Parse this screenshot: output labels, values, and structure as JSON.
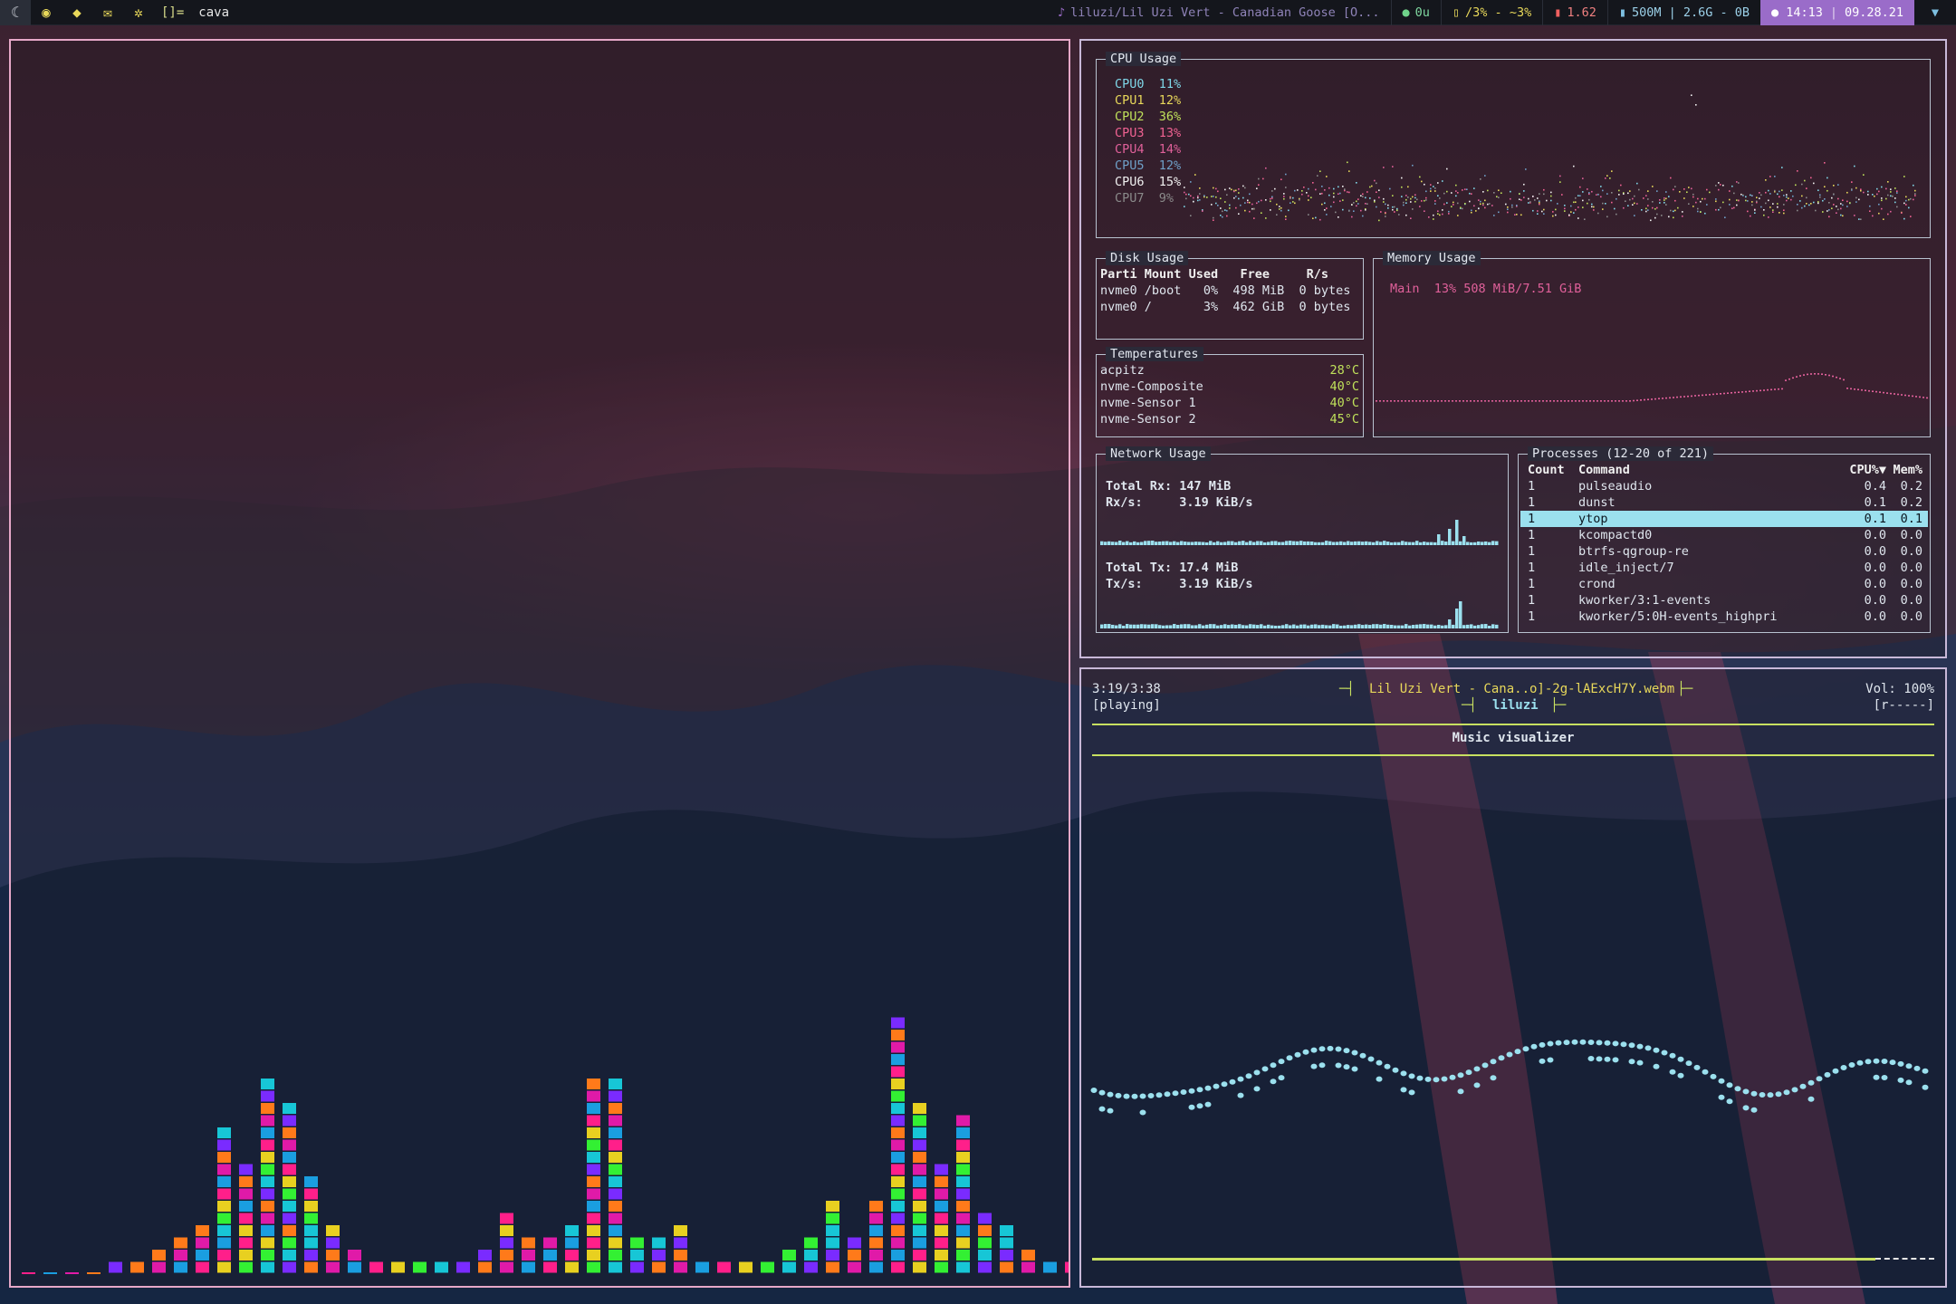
{
  "topbar": {
    "workspaces": [
      {
        "icon": "☾",
        "name": "workspace-1"
      },
      {
        "icon": "◉",
        "name": "workspace-2"
      },
      {
        "icon": "◆",
        "name": "workspace-3"
      },
      {
        "icon": "✉",
        "name": "workspace-4"
      },
      {
        "icon": "✲",
        "name": "workspace-5"
      }
    ],
    "layout": "[]=",
    "window_title": "cava",
    "now_playing": "liluzi/Lil Uzi Vert - Canadian Goose [O...",
    "updates": "0u",
    "cpu": "/3% - ~3%",
    "temp": "1.62",
    "memory": "500M | 2.6G - 0B",
    "time": "14:13",
    "date": "09.28.21"
  },
  "ytop": {
    "cpu": {
      "title": "CPU Usage",
      "cores": [
        {
          "label": "CPU0",
          "pct": "11%",
          "color": "#7fd7e8"
        },
        {
          "label": "CPU1",
          "pct": "12%",
          "color": "#e8d85a"
        },
        {
          "label": "CPU2",
          "pct": "36%",
          "color": "#bfe05a"
        },
        {
          "label": "CPU3",
          "pct": "13%",
          "color": "#f06292"
        },
        {
          "label": "CPU4",
          "pct": "14%",
          "color": "#e0609a"
        },
        {
          "label": "CPU5",
          "pct": "12%",
          "color": "#6fa0c8"
        },
        {
          "label": "CPU6",
          "pct": "15%",
          "color": "#f0f0f0"
        },
        {
          "label": "CPU7",
          "pct": "9%",
          "color": "#8a8a8a"
        }
      ]
    },
    "disk": {
      "title": "Disk Usage",
      "headers": [
        "Parti",
        "Mount",
        "Used",
        "Free",
        "R/s"
      ],
      "rows": [
        [
          "nvme0",
          "/boot",
          "0%",
          "498 MiB",
          "0 bytes"
        ],
        [
          "nvme0",
          "/",
          "3%",
          "462 GiB",
          "0 bytes"
        ]
      ]
    },
    "temps": {
      "title": "Temperatures",
      "rows": [
        {
          "name": "acpitz",
          "value": "28°C"
        },
        {
          "name": "nvme-Composite",
          "value": "40°C"
        },
        {
          "name": "nvme-Sensor 1",
          "value": "40°C"
        },
        {
          "name": "nvme-Sensor 2",
          "value": "45°C"
        }
      ]
    },
    "memory": {
      "title": "Memory Usage",
      "main_label": "Main",
      "main_value": "13% 508 MiB/7.51 GiB"
    },
    "network": {
      "title": "Network Usage",
      "total_rx_label": "Total Rx:",
      "total_rx": "147 MiB",
      "rx_label": "Rx/s:",
      "rx": "3.19 KiB/s",
      "total_tx_label": "Total Tx:",
      "total_tx": "17.4 MiB",
      "tx_label": "Tx/s:",
      "tx": "3.19 KiB/s"
    },
    "processes": {
      "title": "Processes (12-20 of 221)",
      "headers": {
        "count": "Count",
        "cmd": "Command",
        "cpu": "CPU%▼",
        "mem": "Mem%"
      },
      "rows": [
        {
          "count": "1",
          "cmd": "pulseaudio",
          "cpu": "0.4",
          "mem": "0.2"
        },
        {
          "count": "1",
          "cmd": "dunst",
          "cpu": "0.1",
          "mem": "0.2"
        },
        {
          "count": "1",
          "cmd": "ytop",
          "cpu": "0.1",
          "mem": "0.1",
          "selected": true
        },
        {
          "count": "1",
          "cmd": "kcompactd0",
          "cpu": "0.0",
          "mem": "0.0"
        },
        {
          "count": "1",
          "cmd": "btrfs-qgroup-re",
          "cpu": "0.0",
          "mem": "0.0"
        },
        {
          "count": "1",
          "cmd": "idle_inject/7",
          "cpu": "0.0",
          "mem": "0.0"
        },
        {
          "count": "1",
          "cmd": "crond",
          "cpu": "0.0",
          "mem": "0.0"
        },
        {
          "count": "1",
          "cmd": "kworker/3:1-events",
          "cpu": "0.0",
          "mem": "0.0"
        },
        {
          "count": "1",
          "cmd": "kworker/5:0H-events_highpri",
          "cpu": "0.0",
          "mem": "0.0"
        }
      ]
    }
  },
  "mpd": {
    "elapsed": "3:19/3:38",
    "state": "[playing]",
    "track": "Lil Uzi Vert - Cana..o]-2g-lAExcH7Y.webm",
    "artist": "liluzi",
    "volume": "Vol: 100%",
    "flags": "[r-----]",
    "section_title": "Music visualizer",
    "progress": 0.93
  },
  "cava": {
    "bar_levels": [
      0.2,
      0.2,
      0.2,
      0.2,
      1,
      1,
      2,
      3,
      4,
      12,
      9,
      16,
      14,
      8,
      4,
      2,
      1,
      1,
      1,
      1,
      1,
      2,
      5,
      3,
      3,
      4,
      16,
      16,
      3,
      3,
      4,
      1,
      1,
      1,
      1,
      2,
      3,
      6,
      3,
      6,
      21,
      14,
      9,
      13,
      5,
      4,
      2,
      1,
      1,
      0,
      0,
      0,
      0,
      0
    ],
    "bar_colors": [
      "#ff1f8a",
      "#ff7a1a",
      "#33f033",
      "#1a9ee0",
      "#7a2bff",
      "#e8d020",
      "#e01aa8",
      "#17c6d6"
    ]
  },
  "colors": {
    "accent": "#9a6cc9",
    "border_focused": "#e6a8c8",
    "net_graph": "#9be0ee",
    "mem_graph": "#e0609a",
    "mpd_line": "#c8e060",
    "visualizer": "#9be0ee"
  }
}
